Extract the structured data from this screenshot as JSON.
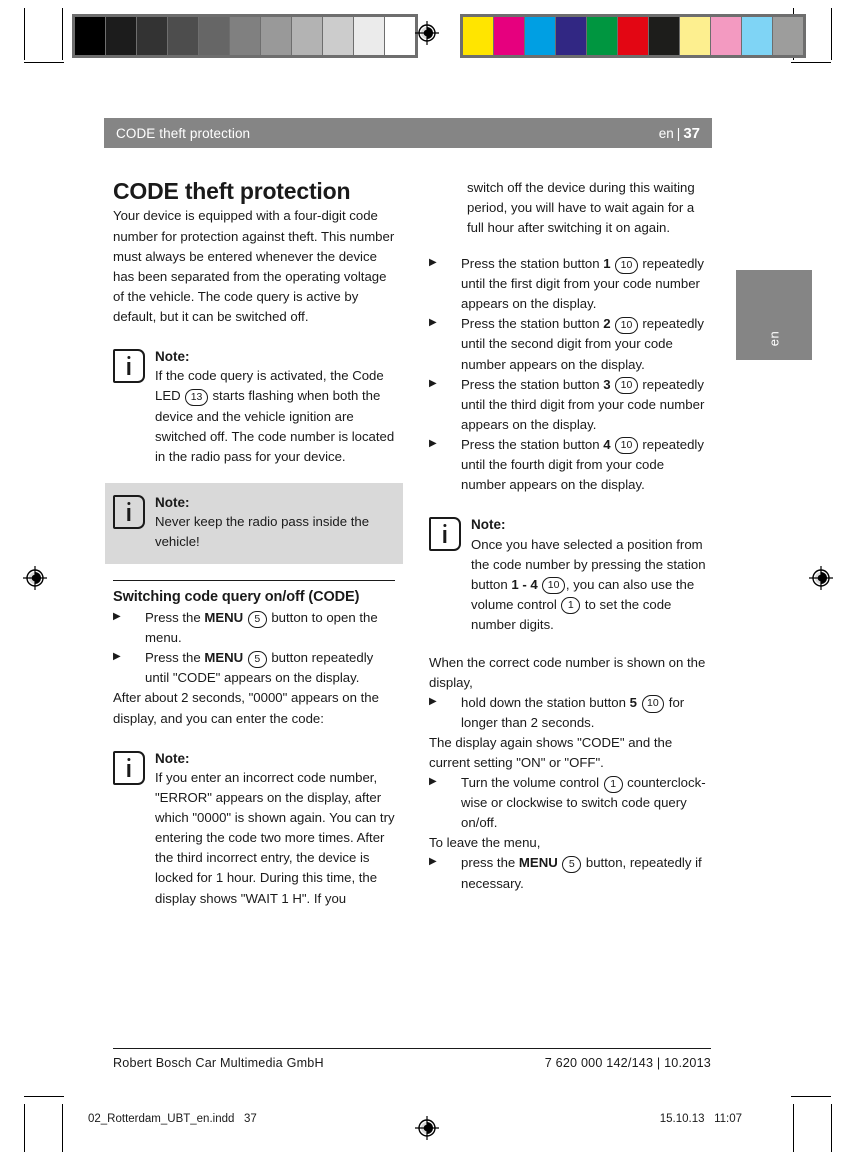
{
  "calibration": {
    "grayscale_swatches": [
      "#000000",
      "#1c1c1c",
      "#333333",
      "#4d4d4d",
      "#666666",
      "#808080",
      "#999999",
      "#b3b3b3",
      "#cccccc",
      "#ebebeb",
      "#ffffff"
    ],
    "color_swatches": [
      "#ffe500",
      "#e6007e",
      "#009fe3",
      "#312783",
      "#009640",
      "#e30613",
      "#1d1d1b",
      "#fdef8f",
      "#f39ac1",
      "#7fd4f5",
      "#9d9d9c"
    ]
  },
  "header": {
    "chapter": "CODE theft protection",
    "language": "en",
    "separator": "|",
    "page_number": "37"
  },
  "lang_tab": {
    "label": "en"
  },
  "left_column": {
    "title": "CODE theft protection",
    "intro": "Your device is equipped with a four-digit code number for protection against theft. This number must always be entered whenever the device has been separated from the operating voltage of the vehicle. The code query is active by default, but it can be switched off.",
    "note1": {
      "title": "Note:",
      "text_before_ref": "If the code query is activated, the Code LED ",
      "ref": "13",
      "text_after_ref": " starts flashing when both the device and the vehicle ignition are switched off. The code number is located in the radio pass for your device."
    },
    "note2": {
      "title": "Note:",
      "text": "Never keep the radio pass inside the vehicle!"
    },
    "subhead": "Switching code query on/off (CODE)",
    "step1": {
      "pre": "Press the ",
      "bold": "MENU",
      "ref": "5",
      "post": " button to open the menu."
    },
    "step2": {
      "pre": "Press the ",
      "bold": "MENU",
      "ref": "5",
      "post": " button repeatedly until \"CODE\" appears on the display."
    },
    "after_steps": "After about 2 seconds, \"0000\" appears on the display, and you can enter the code:",
    "note3": {
      "title": "Note:",
      "text": "If you enter an incorrect code number, \"ERROR\" appears on the display, after which \"0000\" is shown again. You can try entering the code two more times. After the third incorrect entry, the device is locked for 1 hour. During this time, the display shows \"WAIT 1 H\". If you"
    }
  },
  "right_column": {
    "note3_continued": "switch off the device during this waiting period, you will have to wait again for a full hour after switching it on again.",
    "steps": [
      {
        "pre": "Press the station button ",
        "bold": "1",
        "ref": "10",
        "post": " repeatedly until the first digit from your code number appears on the display."
      },
      {
        "pre": "Press the station button ",
        "bold": "2",
        "ref": "10",
        "post": " repeatedly until the second digit from your code number appears on the display."
      },
      {
        "pre": "Press the station button ",
        "bold": "3",
        "ref": "10",
        "post": " repeatedly until the third digit from your code number appears on the display."
      },
      {
        "pre": "Press the station button ",
        "bold": "4",
        "ref": "10",
        "post": " repeatedly until the fourth digit from your code number appears on the display."
      }
    ],
    "note4": {
      "title": "Note:",
      "p1": "Once you have selected a position from the code number by pressing the station button ",
      "bold1": "1 - 4",
      "ref1": "10",
      "p2": ", you can also use the volume control ",
      "ref2": "1",
      "p3": " to set the code number digits."
    },
    "para_correct": "When the correct code number is shown on the display,",
    "step_hold": {
      "pre": "hold down the station button ",
      "bold": "5",
      "ref": "10",
      "post": " for longer than 2 seconds."
    },
    "para_display": "The display again shows \"CODE\" and the current setting \"ON\" or \"OFF\".",
    "step_turn": {
      "pre": "Turn the volume control ",
      "ref": "1",
      "post": " counterclock-wise or clockwise to switch code query on/off."
    },
    "para_leave": "To leave the menu,",
    "step_leave": {
      "pre": "press the ",
      "bold": "MENU",
      "ref": "5",
      "post": " button, repeatedly if necessary."
    }
  },
  "footer": {
    "company": "Robert Bosch Car Multimedia GmbH",
    "doc_id": "7 620 000 142/143 | 10.2013"
  },
  "slug": {
    "filename": "02_Rotterdam_UBT_en.indd   37",
    "timestamp": "15.10.13   11:07"
  },
  "icons": {
    "note": "info-icon",
    "bullet": "triangle-bullet-icon",
    "registration": "registration-mark-icon"
  }
}
